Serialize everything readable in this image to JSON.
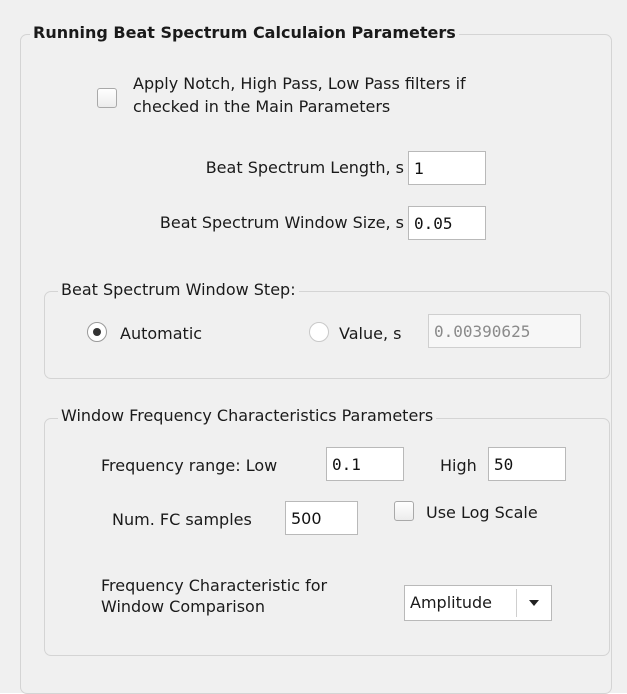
{
  "main_group": {
    "title": "Running Beat Spectrum Calculaion Parameters",
    "apply_filters": {
      "line1": "Apply Notch, High Pass, Low Pass filters if",
      "line2": "checked in the Main Parameters",
      "checked": false
    },
    "beat_length": {
      "label": "Beat Spectrum Length, s",
      "value": "1"
    },
    "window_size": {
      "label": "Beat Spectrum Window Size, s",
      "value": "0.05"
    }
  },
  "window_step": {
    "title": "Beat Spectrum Window Step:",
    "automatic_label": "Automatic",
    "value_label": "Value, s",
    "value": "0.00390625",
    "selected": "Automatic"
  },
  "freq_params": {
    "title": "Window Frequency Characteristics Parameters",
    "range_label": "Frequency range: Low",
    "low_value": "0.1",
    "high_label": "High",
    "high_value": "50",
    "samples_label": "Num. FC samples",
    "samples_value": "500",
    "log_scale_label": "Use Log Scale",
    "log_scale_checked": false,
    "comparison_label_line1": "Frequency Characteristic for",
    "comparison_label_line2": "Window Comparison",
    "comparison_value": "Amplitude"
  },
  "icons": {
    "dropdown_arrow": "chevron-down-icon"
  }
}
